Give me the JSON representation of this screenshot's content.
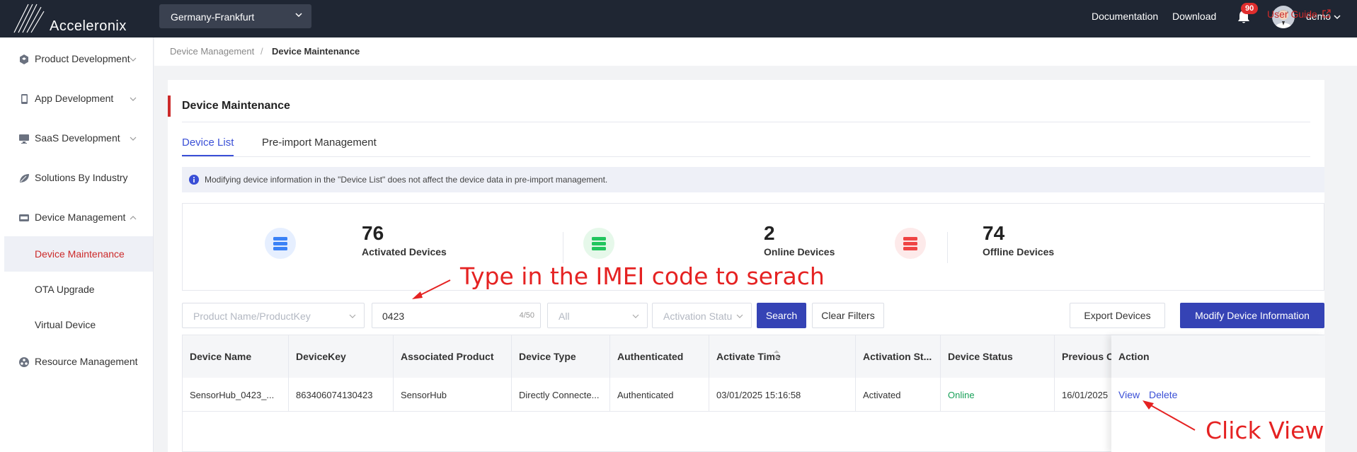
{
  "app": {
    "name": "Acceleronix",
    "region": "Germany-Frankfurt"
  },
  "header": {
    "documentation": "Documentation",
    "download": "Download",
    "notification_count": "90",
    "username": "demo"
  },
  "sidebar": {
    "items": [
      {
        "label": "Product Development",
        "icon": "cube-icon"
      },
      {
        "label": "App Development",
        "icon": "phone-icon"
      },
      {
        "label": "SaaS Development",
        "icon": "monitor-icon"
      },
      {
        "label": "Solutions By Industry",
        "icon": "leaf-icon"
      },
      {
        "label": "Device Management",
        "icon": "device-icon"
      },
      {
        "label": "Resource Management",
        "icon": "resource-icon"
      }
    ],
    "sub_items": [
      "Device Maintenance",
      "OTA Upgrade",
      "Virtual Device"
    ]
  },
  "breadcrumb": {
    "parent": "Device Management",
    "separator": "/",
    "current": "Device Maintenance"
  },
  "user_guide": "User Guide",
  "page": {
    "title": "Device Maintenance",
    "tabs": [
      "Device List",
      "Pre-import Management"
    ],
    "notice": "Modifying device information in the \"Device List\" does not affect the device data in pre-import management."
  },
  "stats": [
    {
      "value": "76",
      "label": "Activated Devices",
      "color": "#3b82f6"
    },
    {
      "value": "2",
      "label": "Online Devices",
      "color": "#22c55e"
    },
    {
      "value": "74",
      "label": "Offline Devices",
      "color": "#ef4444"
    }
  ],
  "filters": {
    "product_placeholder": "Product Name/ProductKey",
    "search_value": "0423",
    "search_count": "4/50",
    "status_value": "All",
    "activation_placeholder": "Activation Statu",
    "search_btn": "Search",
    "clear_btn": "Clear Filters",
    "export_btn": "Export Devices",
    "modify_btn": "Modify Device Information"
  },
  "table": {
    "headers": [
      "Device Name",
      "DeviceKey",
      "Associated Product",
      "Device Type",
      "Authenticated",
      "Activate Time",
      "Activation St...",
      "Device Status",
      "Previous O",
      "Action"
    ],
    "rows": [
      {
        "device_name": "SensorHub_0423_...",
        "device_key": "863406074130423",
        "product": "SensorHub",
        "type": "Directly Connecte...",
        "authenticated": "Authenticated",
        "activate_time": "03/01/2025 15:16:58",
        "activation": "Activated",
        "status": "Online",
        "previous": "16/01/2025",
        "view": "View",
        "delete": "Delete"
      }
    ]
  },
  "annotations": {
    "imei": "Type in the IMEI code to serach",
    "view": "Click View"
  }
}
